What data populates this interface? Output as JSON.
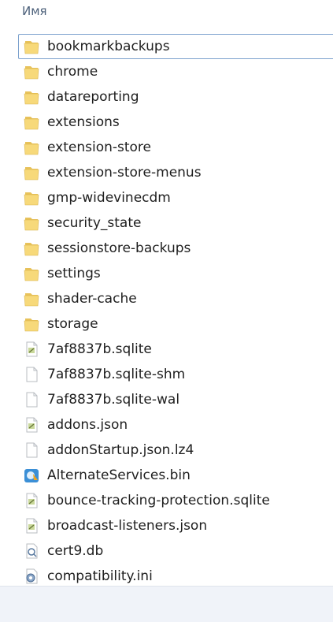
{
  "header": {
    "column_name": "Имя"
  },
  "files": [
    {
      "name": "bookmarkbackups",
      "icon": "folder-icon",
      "selected": true
    },
    {
      "name": "chrome",
      "icon": "folder-icon"
    },
    {
      "name": "datareporting",
      "icon": "folder-icon"
    },
    {
      "name": "extensions",
      "icon": "folder-icon"
    },
    {
      "name": "extension-store",
      "icon": "folder-icon"
    },
    {
      "name": "extension-store-menus",
      "icon": "folder-icon"
    },
    {
      "name": "gmp-widevinecdm",
      "icon": "folder-icon"
    },
    {
      "name": "security_state",
      "icon": "folder-icon"
    },
    {
      "name": "sessionstore-backups",
      "icon": "folder-icon"
    },
    {
      "name": "settings",
      "icon": "folder-icon"
    },
    {
      "name": "shader-cache",
      "icon": "folder-icon"
    },
    {
      "name": "storage",
      "icon": "folder-icon"
    },
    {
      "name": "7af8837b.sqlite",
      "icon": "sqlite-file-icon"
    },
    {
      "name": "7af8837b.sqlite-shm",
      "icon": "blank-file-icon"
    },
    {
      "name": "7af8837b.sqlite-wal",
      "icon": "blank-file-icon"
    },
    {
      "name": "addons.json",
      "icon": "text-file-icon"
    },
    {
      "name": "addonStartup.json.lz4",
      "icon": "blank-file-icon"
    },
    {
      "name": "AlternateServices.bin",
      "icon": "bin-file-icon"
    },
    {
      "name": "bounce-tracking-protection.sqlite",
      "icon": "sqlite-file-icon"
    },
    {
      "name": "broadcast-listeners.json",
      "icon": "text-file-icon"
    },
    {
      "name": "cert9.db",
      "icon": "db-file-icon"
    },
    {
      "name": "compatibility.ini",
      "icon": "ini-file-icon"
    }
  ]
}
